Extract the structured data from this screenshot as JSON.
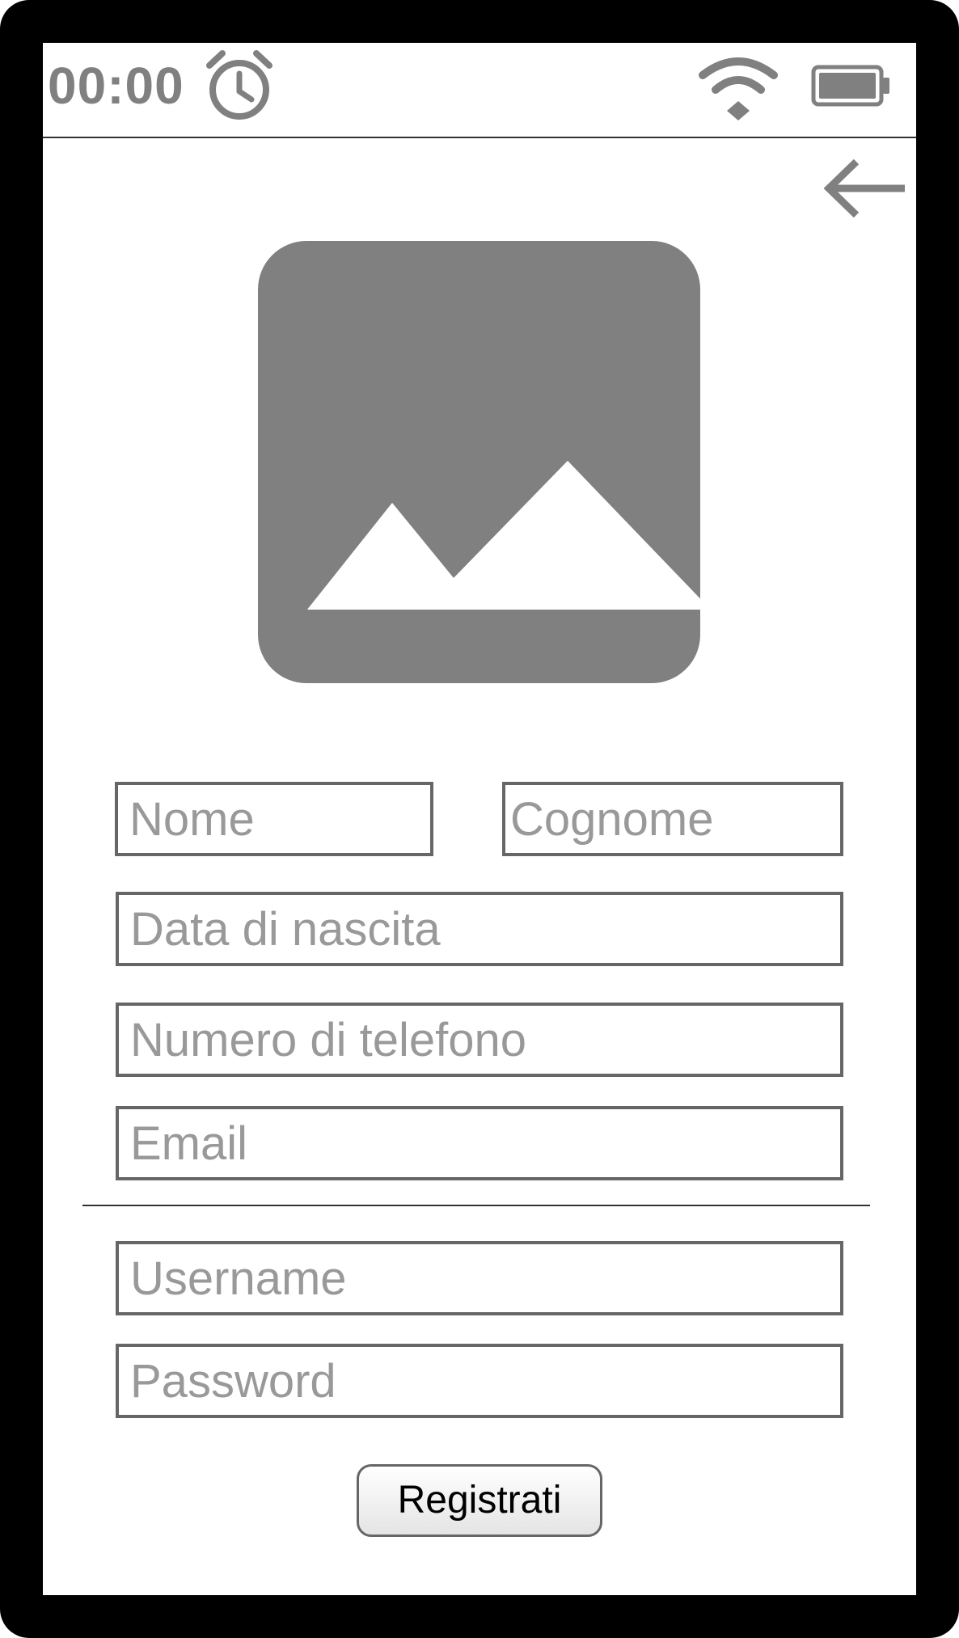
{
  "status_bar": {
    "time": "00:00",
    "icons": [
      "alarm-clock-icon",
      "wifi-icon",
      "battery-icon"
    ]
  },
  "header": {
    "back_icon": "arrow-left-icon"
  },
  "hero": {
    "icon": "image-placeholder-icon"
  },
  "form": {
    "nome_placeholder": "Nome",
    "cognome_placeholder": "Cognome",
    "data_nascita_placeholder": "Data di nascita",
    "telefono_placeholder": "Numero di telefono",
    "email_placeholder": "Email",
    "username_placeholder": "Username",
    "password_placeholder": "Password",
    "submit_label": "Registrati"
  },
  "colors": {
    "frame": "#000000",
    "icon_gray": "#808080",
    "field_border": "#666666",
    "placeholder": "#999999"
  }
}
